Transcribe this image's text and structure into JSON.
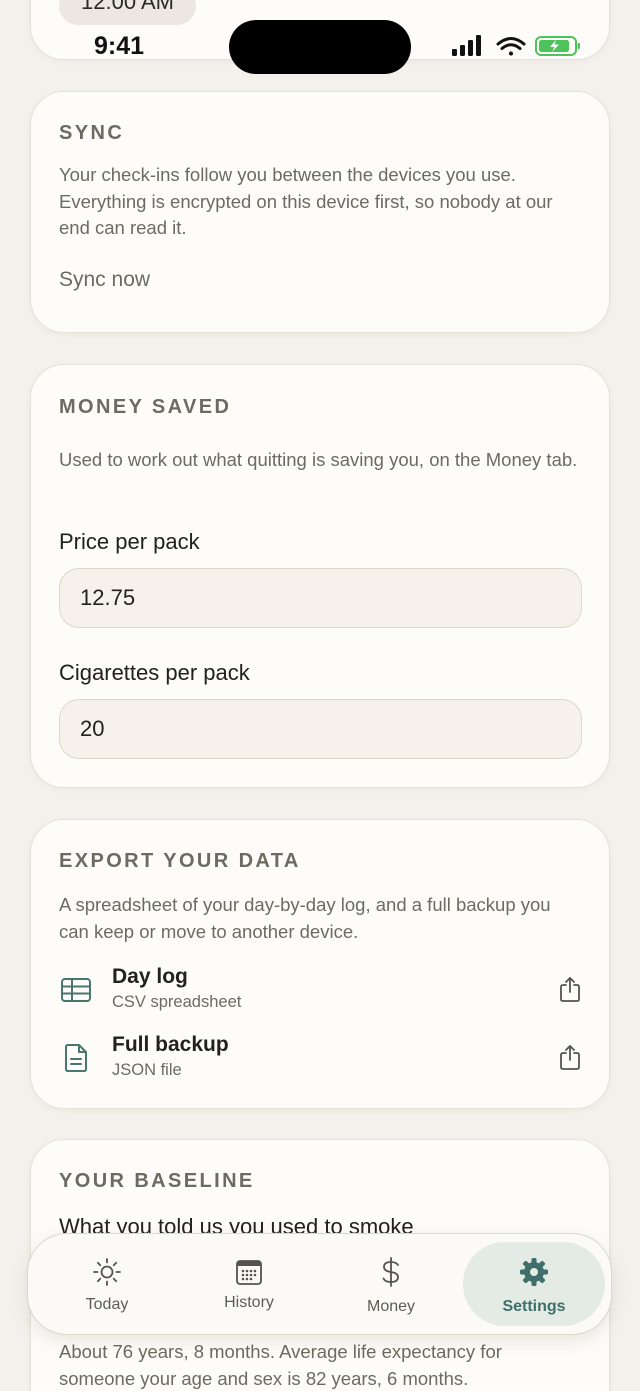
{
  "status_bar": {
    "time": "9:41"
  },
  "top_card": {
    "time_pill": "12:00 AM"
  },
  "sync": {
    "title": "SYNC",
    "description": "Your check-ins follow you between the devices you use. Everything is encrypted on this device first, so nobody at our end can read it.",
    "action": "Sync now"
  },
  "money_saved": {
    "title": "MONEY SAVED",
    "description": "Used to work out what quitting is saving you, on the Money tab.",
    "price_label": "Price per pack",
    "price_value": "12.75",
    "cigs_label": "Cigarettes per pack",
    "cigs_value": "20"
  },
  "export": {
    "title": "EXPORT YOUR DATA",
    "description": "A spreadsheet of your day-by-day log, and a full backup you can keep or move to another device.",
    "items": [
      {
        "title": "Day log",
        "subtitle": "CSV spreadsheet",
        "icon": "table-icon"
      },
      {
        "title": "Full backup",
        "subtitle": "JSON file",
        "icon": "document-icon"
      }
    ]
  },
  "baseline": {
    "title": "YOUR BASELINE",
    "subtitle": "What you told us you used to smoke",
    "life_text": "About 76 years, 8 months. Average life expectancy for someone your age and sex is 82 years, 6 months."
  },
  "tabs": [
    {
      "label": "Today",
      "icon": "sun-icon"
    },
    {
      "label": "History",
      "icon": "calendar-icon"
    },
    {
      "label": "Money",
      "icon": "dollar-icon"
    },
    {
      "label": "Settings",
      "icon": "gear-icon"
    }
  ],
  "active_tab": "Settings",
  "accent_color": "#3f6f6a"
}
